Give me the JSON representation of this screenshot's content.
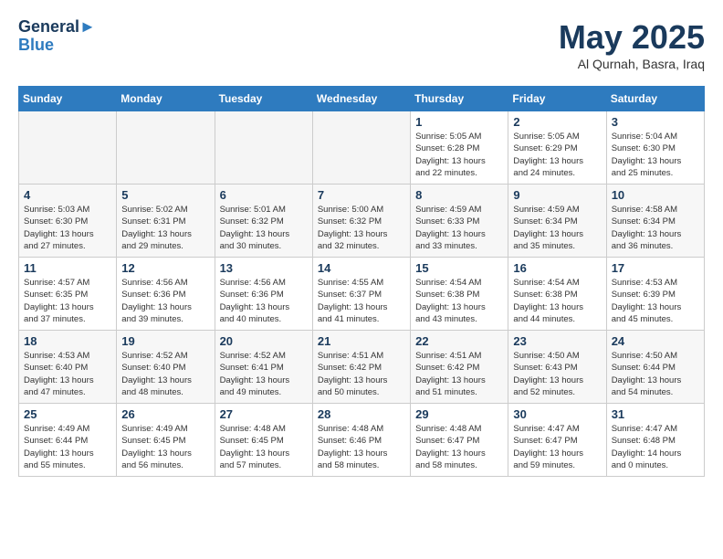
{
  "header": {
    "logo_line1": "General",
    "logo_line2": "Blue",
    "month_title": "May 2025",
    "location": "Al Qurnah, Basra, Iraq"
  },
  "days_of_week": [
    "Sunday",
    "Monday",
    "Tuesday",
    "Wednesday",
    "Thursday",
    "Friday",
    "Saturday"
  ],
  "weeks": [
    [
      {
        "day": "",
        "info": "",
        "empty": true
      },
      {
        "day": "",
        "info": "",
        "empty": true
      },
      {
        "day": "",
        "info": "",
        "empty": true
      },
      {
        "day": "",
        "info": "",
        "empty": true
      },
      {
        "day": "1",
        "info": "Sunrise: 5:05 AM\nSunset: 6:28 PM\nDaylight: 13 hours\nand 22 minutes.",
        "empty": false
      },
      {
        "day": "2",
        "info": "Sunrise: 5:05 AM\nSunset: 6:29 PM\nDaylight: 13 hours\nand 24 minutes.",
        "empty": false
      },
      {
        "day": "3",
        "info": "Sunrise: 5:04 AM\nSunset: 6:30 PM\nDaylight: 13 hours\nand 25 minutes.",
        "empty": false
      }
    ],
    [
      {
        "day": "4",
        "info": "Sunrise: 5:03 AM\nSunset: 6:30 PM\nDaylight: 13 hours\nand 27 minutes.",
        "empty": false
      },
      {
        "day": "5",
        "info": "Sunrise: 5:02 AM\nSunset: 6:31 PM\nDaylight: 13 hours\nand 29 minutes.",
        "empty": false
      },
      {
        "day": "6",
        "info": "Sunrise: 5:01 AM\nSunset: 6:32 PM\nDaylight: 13 hours\nand 30 minutes.",
        "empty": false
      },
      {
        "day": "7",
        "info": "Sunrise: 5:00 AM\nSunset: 6:32 PM\nDaylight: 13 hours\nand 32 minutes.",
        "empty": false
      },
      {
        "day": "8",
        "info": "Sunrise: 4:59 AM\nSunset: 6:33 PM\nDaylight: 13 hours\nand 33 minutes.",
        "empty": false
      },
      {
        "day": "9",
        "info": "Sunrise: 4:59 AM\nSunset: 6:34 PM\nDaylight: 13 hours\nand 35 minutes.",
        "empty": false
      },
      {
        "day": "10",
        "info": "Sunrise: 4:58 AM\nSunset: 6:34 PM\nDaylight: 13 hours\nand 36 minutes.",
        "empty": false
      }
    ],
    [
      {
        "day": "11",
        "info": "Sunrise: 4:57 AM\nSunset: 6:35 PM\nDaylight: 13 hours\nand 37 minutes.",
        "empty": false
      },
      {
        "day": "12",
        "info": "Sunrise: 4:56 AM\nSunset: 6:36 PM\nDaylight: 13 hours\nand 39 minutes.",
        "empty": false
      },
      {
        "day": "13",
        "info": "Sunrise: 4:56 AM\nSunset: 6:36 PM\nDaylight: 13 hours\nand 40 minutes.",
        "empty": false
      },
      {
        "day": "14",
        "info": "Sunrise: 4:55 AM\nSunset: 6:37 PM\nDaylight: 13 hours\nand 41 minutes.",
        "empty": false
      },
      {
        "day": "15",
        "info": "Sunrise: 4:54 AM\nSunset: 6:38 PM\nDaylight: 13 hours\nand 43 minutes.",
        "empty": false
      },
      {
        "day": "16",
        "info": "Sunrise: 4:54 AM\nSunset: 6:38 PM\nDaylight: 13 hours\nand 44 minutes.",
        "empty": false
      },
      {
        "day": "17",
        "info": "Sunrise: 4:53 AM\nSunset: 6:39 PM\nDaylight: 13 hours\nand 45 minutes.",
        "empty": false
      }
    ],
    [
      {
        "day": "18",
        "info": "Sunrise: 4:53 AM\nSunset: 6:40 PM\nDaylight: 13 hours\nand 47 minutes.",
        "empty": false
      },
      {
        "day": "19",
        "info": "Sunrise: 4:52 AM\nSunset: 6:40 PM\nDaylight: 13 hours\nand 48 minutes.",
        "empty": false
      },
      {
        "day": "20",
        "info": "Sunrise: 4:52 AM\nSunset: 6:41 PM\nDaylight: 13 hours\nand 49 minutes.",
        "empty": false
      },
      {
        "day": "21",
        "info": "Sunrise: 4:51 AM\nSunset: 6:42 PM\nDaylight: 13 hours\nand 50 minutes.",
        "empty": false
      },
      {
        "day": "22",
        "info": "Sunrise: 4:51 AM\nSunset: 6:42 PM\nDaylight: 13 hours\nand 51 minutes.",
        "empty": false
      },
      {
        "day": "23",
        "info": "Sunrise: 4:50 AM\nSunset: 6:43 PM\nDaylight: 13 hours\nand 52 minutes.",
        "empty": false
      },
      {
        "day": "24",
        "info": "Sunrise: 4:50 AM\nSunset: 6:44 PM\nDaylight: 13 hours\nand 54 minutes.",
        "empty": false
      }
    ],
    [
      {
        "day": "25",
        "info": "Sunrise: 4:49 AM\nSunset: 6:44 PM\nDaylight: 13 hours\nand 55 minutes.",
        "empty": false
      },
      {
        "day": "26",
        "info": "Sunrise: 4:49 AM\nSunset: 6:45 PM\nDaylight: 13 hours\nand 56 minutes.",
        "empty": false
      },
      {
        "day": "27",
        "info": "Sunrise: 4:48 AM\nSunset: 6:45 PM\nDaylight: 13 hours\nand 57 minutes.",
        "empty": false
      },
      {
        "day": "28",
        "info": "Sunrise: 4:48 AM\nSunset: 6:46 PM\nDaylight: 13 hours\nand 58 minutes.",
        "empty": false
      },
      {
        "day": "29",
        "info": "Sunrise: 4:48 AM\nSunset: 6:47 PM\nDaylight: 13 hours\nand 58 minutes.",
        "empty": false
      },
      {
        "day": "30",
        "info": "Sunrise: 4:47 AM\nSunset: 6:47 PM\nDaylight: 13 hours\nand 59 minutes.",
        "empty": false
      },
      {
        "day": "31",
        "info": "Sunrise: 4:47 AM\nSunset: 6:48 PM\nDaylight: 14 hours\nand 0 minutes.",
        "empty": false
      }
    ]
  ]
}
